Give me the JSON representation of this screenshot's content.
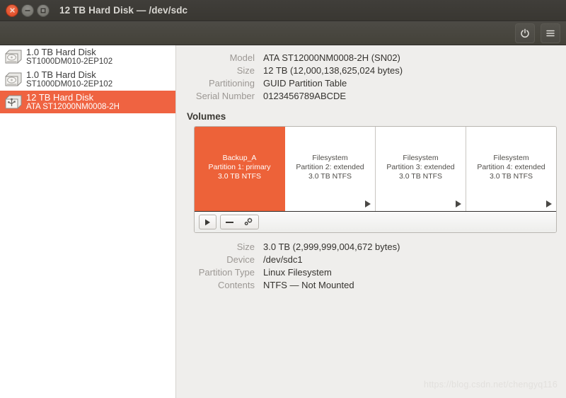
{
  "window": {
    "title": "12 TB Hard Disk — /dev/sdc",
    "controls": {
      "close": "close-button",
      "minimize": "minimize-button",
      "maximize": "maximize-button"
    }
  },
  "headerbar": {
    "power_button_label": "power-icon",
    "menu_button_label": "hamburger-menu-icon"
  },
  "sidebar": {
    "disks": [
      {
        "name": "1.0 TB Hard Disk",
        "model": "ST1000DM010-2EP102",
        "icon": "hard-disk-icon",
        "selected": false
      },
      {
        "name": "1.0 TB Hard Disk",
        "model": "ST1000DM010-2EP102",
        "icon": "hard-disk-icon",
        "selected": false
      },
      {
        "name": "12 TB Hard Disk",
        "model": "ATA ST12000NM0008-2H",
        "icon": "usb-hard-disk-icon",
        "selected": true
      }
    ]
  },
  "drive_details": {
    "rows": [
      {
        "label": "Model",
        "value": "ATA ST12000NM0008-2H (SN02)"
      },
      {
        "label": "Size",
        "value": "12 TB (12,000,138,625,024 bytes)"
      },
      {
        "label": "Partitioning",
        "value": "GUID Partition Table"
      },
      {
        "label": "Serial Number",
        "value": "0123456789ABCDE"
      }
    ]
  },
  "volumes": {
    "title": "Volumes",
    "partitions": [
      {
        "name": "Backup_A",
        "partition": "Partition 1: primary",
        "size": "3.0 TB NTFS",
        "selected": true,
        "has_arrow": false
      },
      {
        "name": "Filesystem",
        "partition": "Partition 2: extended",
        "size": "3.0 TB NTFS",
        "selected": false,
        "has_arrow": true
      },
      {
        "name": "Filesystem",
        "partition": "Partition 3: extended",
        "size": "3.0 TB NTFS",
        "selected": false,
        "has_arrow": true
      },
      {
        "name": "Filesystem",
        "partition": "Partition 4: extended",
        "size": "3.0 TB NTFS",
        "selected": false,
        "has_arrow": true
      }
    ],
    "toolbar": {
      "mount_label": "play-icon",
      "delete_label": "minus-icon",
      "settings_label": "gears-icon"
    }
  },
  "partition_details": {
    "rows": [
      {
        "label": "Size",
        "value": "3.0 TB (2,999,999,004,672 bytes)"
      },
      {
        "label": "Device",
        "value": "/dev/sdc1"
      },
      {
        "label": "Partition Type",
        "value": "Linux Filesystem"
      },
      {
        "label": "Contents",
        "value": "NTFS — Not Mounted"
      }
    ]
  },
  "watermark": "https://blog.csdn.net/chengyq116",
  "colors": {
    "selection_orange": "#ef6341",
    "partition_orange": "#ed6239",
    "titlebar": "#3c3a35",
    "headerbar": "#4a4841",
    "content_bg": "#efeeec",
    "label_gray": "#9c9894"
  }
}
